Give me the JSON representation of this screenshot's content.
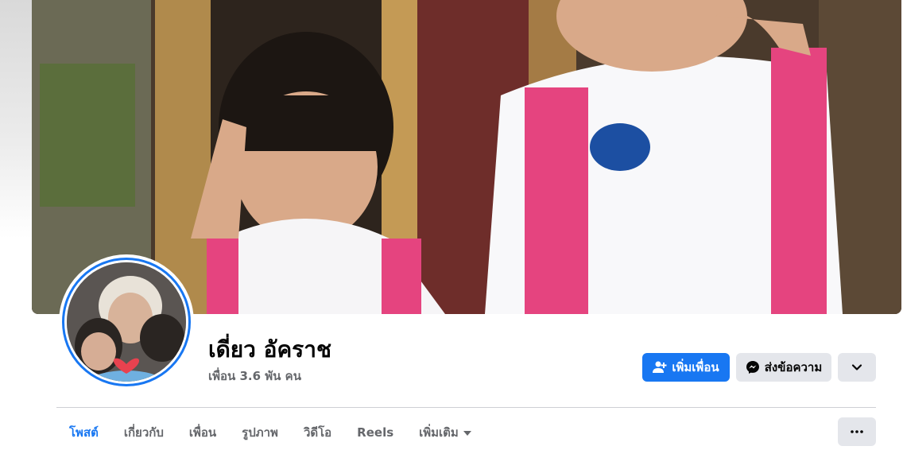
{
  "profile": {
    "name": "เดี่ยว อัคราช",
    "friends_count": "เพื่อน 3.6 พัน คน"
  },
  "actions": {
    "add_friend": "เพิ่มเพื่อน",
    "message": "ส่งข้อความ"
  },
  "tabs": [
    {
      "label": "โพสต์",
      "active": true
    },
    {
      "label": "เกี่ยวกับ",
      "active": false
    },
    {
      "label": "เพื่อน",
      "active": false
    },
    {
      "label": "รูปภาพ",
      "active": false
    },
    {
      "label": "วิดีโอ",
      "active": false
    },
    {
      "label": "Reels",
      "active": false
    },
    {
      "label": "เพิ่มเติม",
      "active": false
    }
  ],
  "icons": {
    "add_friend": "person-plus-icon",
    "message": "messenger-icon",
    "more_profile": "chevron-down-icon",
    "more_tabs": "caret-down-icon",
    "dots": "ellipsis-icon"
  },
  "colors": {
    "accent": "#1877f2",
    "secondary_button": "#e4e6eb",
    "muted_text": "#65676b",
    "text": "#050505"
  }
}
